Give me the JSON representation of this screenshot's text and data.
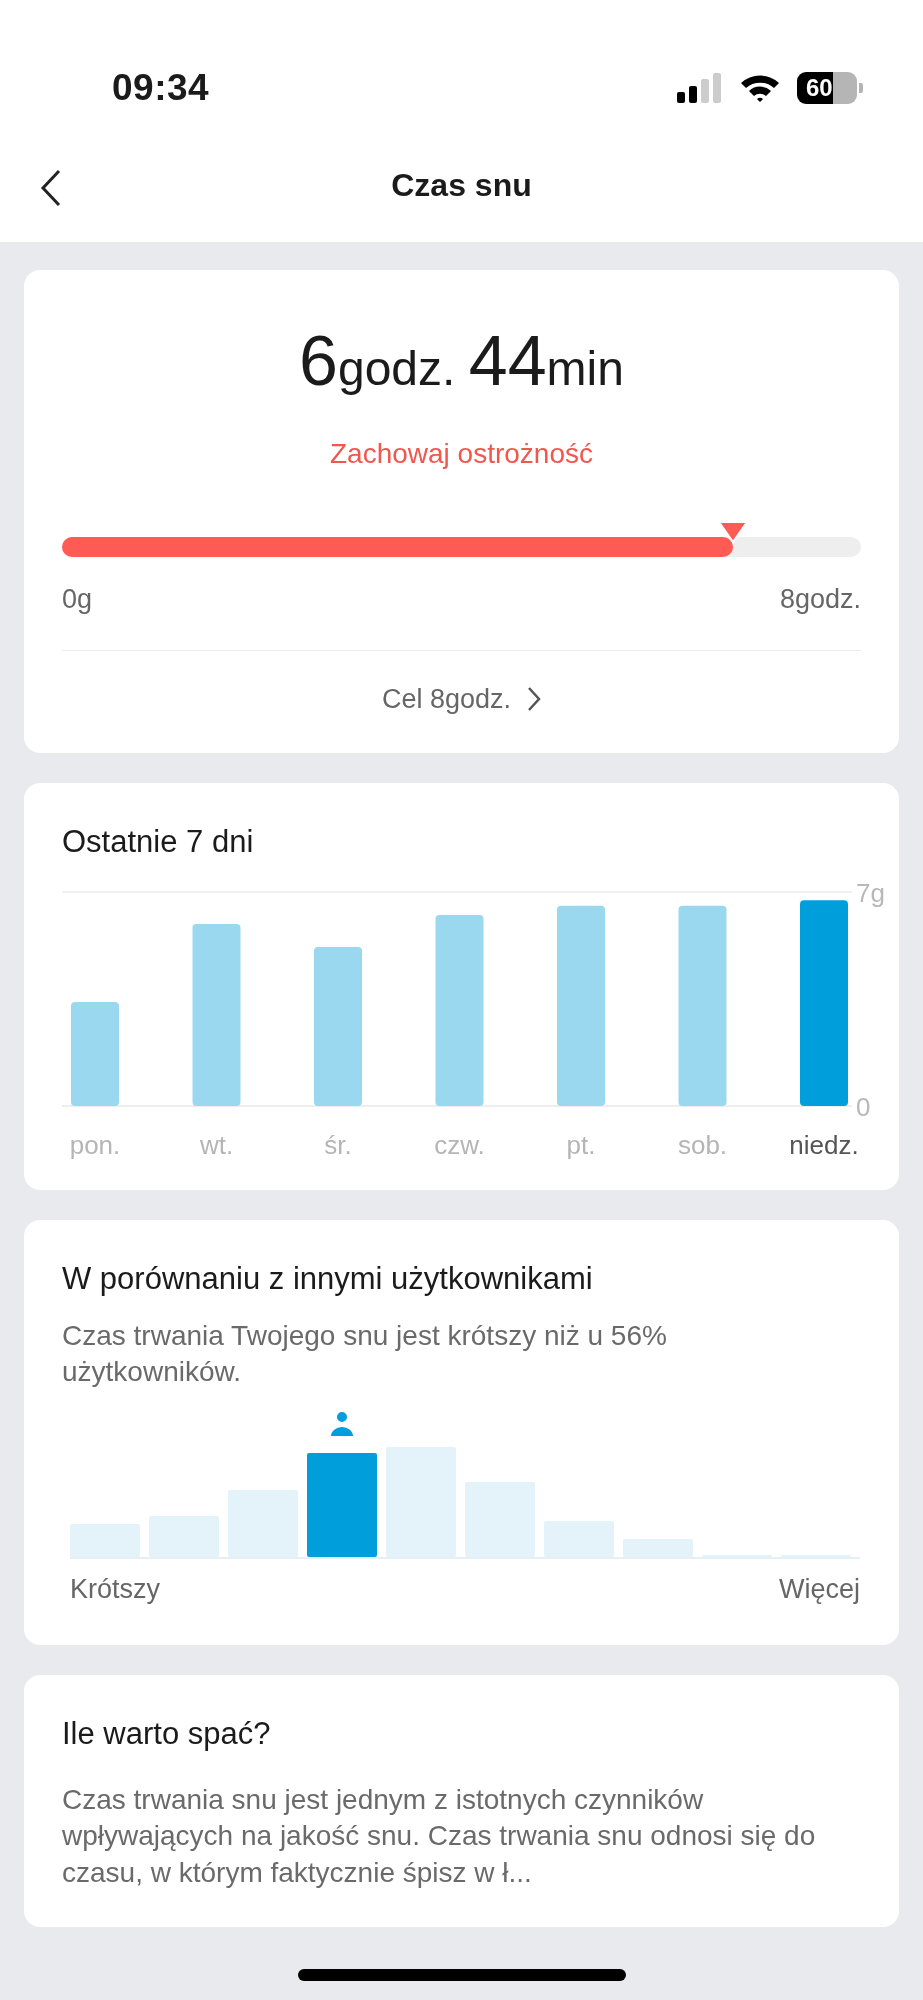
{
  "status_bar": {
    "time": "09:34",
    "battery": "60"
  },
  "header": {
    "title": "Czas snu"
  },
  "summary": {
    "hours": "6",
    "hours_unit": "godz.",
    "minutes": "44",
    "minutes_unit": "min",
    "status": "Zachowaj ostrożność",
    "level": 0.84,
    "min_label": "0g",
    "max_label": "8godz.",
    "goal": "Cel 8godz."
  },
  "week": {
    "title": "Ostatnie 7 dni",
    "chart_data": {
      "type": "bar",
      "categories": [
        "pon.",
        "wt.",
        "śr.",
        "czw.",
        "pt.",
        "sob.",
        "niedz."
      ],
      "series": [
        {
          "color": "#9ad8f0",
          "values": [
            3.4,
            5.95,
            5.2,
            6.25,
            6.55,
            6.55,
            null
          ]
        },
        {
          "color": "#009fdb",
          "values": [
            null,
            null,
            null,
            null,
            null,
            null,
            6.73
          ]
        }
      ],
      "stacked": true,
      "ylim": [
        0,
        7
      ],
      "yticks": [
        {
          "value": 0,
          "label": "0"
        },
        {
          "value": 7,
          "label": "7g"
        }
      ]
    }
  },
  "comparison": {
    "title": "W porównaniu z innymi użytkownikami",
    "text": "Czas trwania Twojego snu jest krótszy niż u 56% użytkowników.",
    "distribution": [
      {
        "selected": false
      },
      {
        "selected": false
      },
      {
        "selected": false
      },
      {
        "selected": true
      },
      {
        "selected": false
      },
      {
        "selected": false
      },
      {
        "selected": false
      },
      {
        "selected": false
      },
      {
        "selected": false
      },
      {
        "selected": false
      }
    ],
    "left_label": "Krótszy",
    "right_label": "Więcej"
  },
  "info": {
    "title": "Ile warto spać?",
    "text": "Czas trwania snu jest jednym z istotnych czynników wpływających na jakość snu. Czas trwania snu odnosi się do czasu, w którym faktycznie śpisz w ł..."
  }
}
